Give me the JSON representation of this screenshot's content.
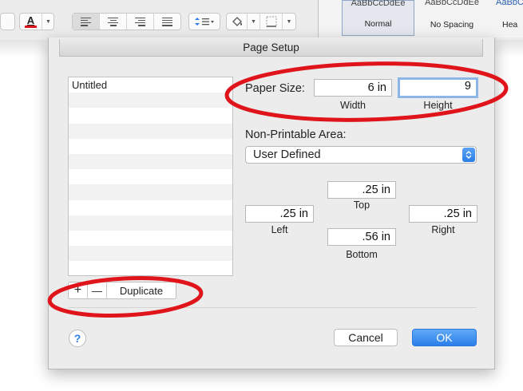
{
  "toolbar": {
    "font_color_letter": "A",
    "styles": [
      {
        "sample": "AaBbCcDdEe",
        "label": "Normal",
        "selected": true
      },
      {
        "sample": "AaBbCcDdEe",
        "label": "No Spacing",
        "selected": false
      },
      {
        "sample": "AaBbCcD",
        "label": "Hea",
        "selected": false
      }
    ]
  },
  "dialog": {
    "title": "Page Setup",
    "paper_list": [
      "Untitled"
    ],
    "list_controls": {
      "add": "+",
      "remove": "—",
      "duplicate": "Duplicate"
    },
    "paper_size": {
      "label": "Paper Size:",
      "width_value": "6 in",
      "width_caption": "Width",
      "height_value": "9",
      "height_caption": "Height"
    },
    "non_printable": {
      "label": "Non-Printable Area:",
      "selected": "User Defined",
      "top_value": ".25 in",
      "top_caption": "Top",
      "left_value": ".25 in",
      "left_caption": "Left",
      "right_value": ".25 in",
      "right_caption": "Right",
      "bottom_value": ".56 in",
      "bottom_caption": "Bottom"
    },
    "help": "?",
    "cancel": "Cancel",
    "ok": "OK"
  },
  "colors": {
    "annotation": "#e0151b",
    "accent": "#2a7fe9",
    "font_color_bar": "#e0151b"
  }
}
